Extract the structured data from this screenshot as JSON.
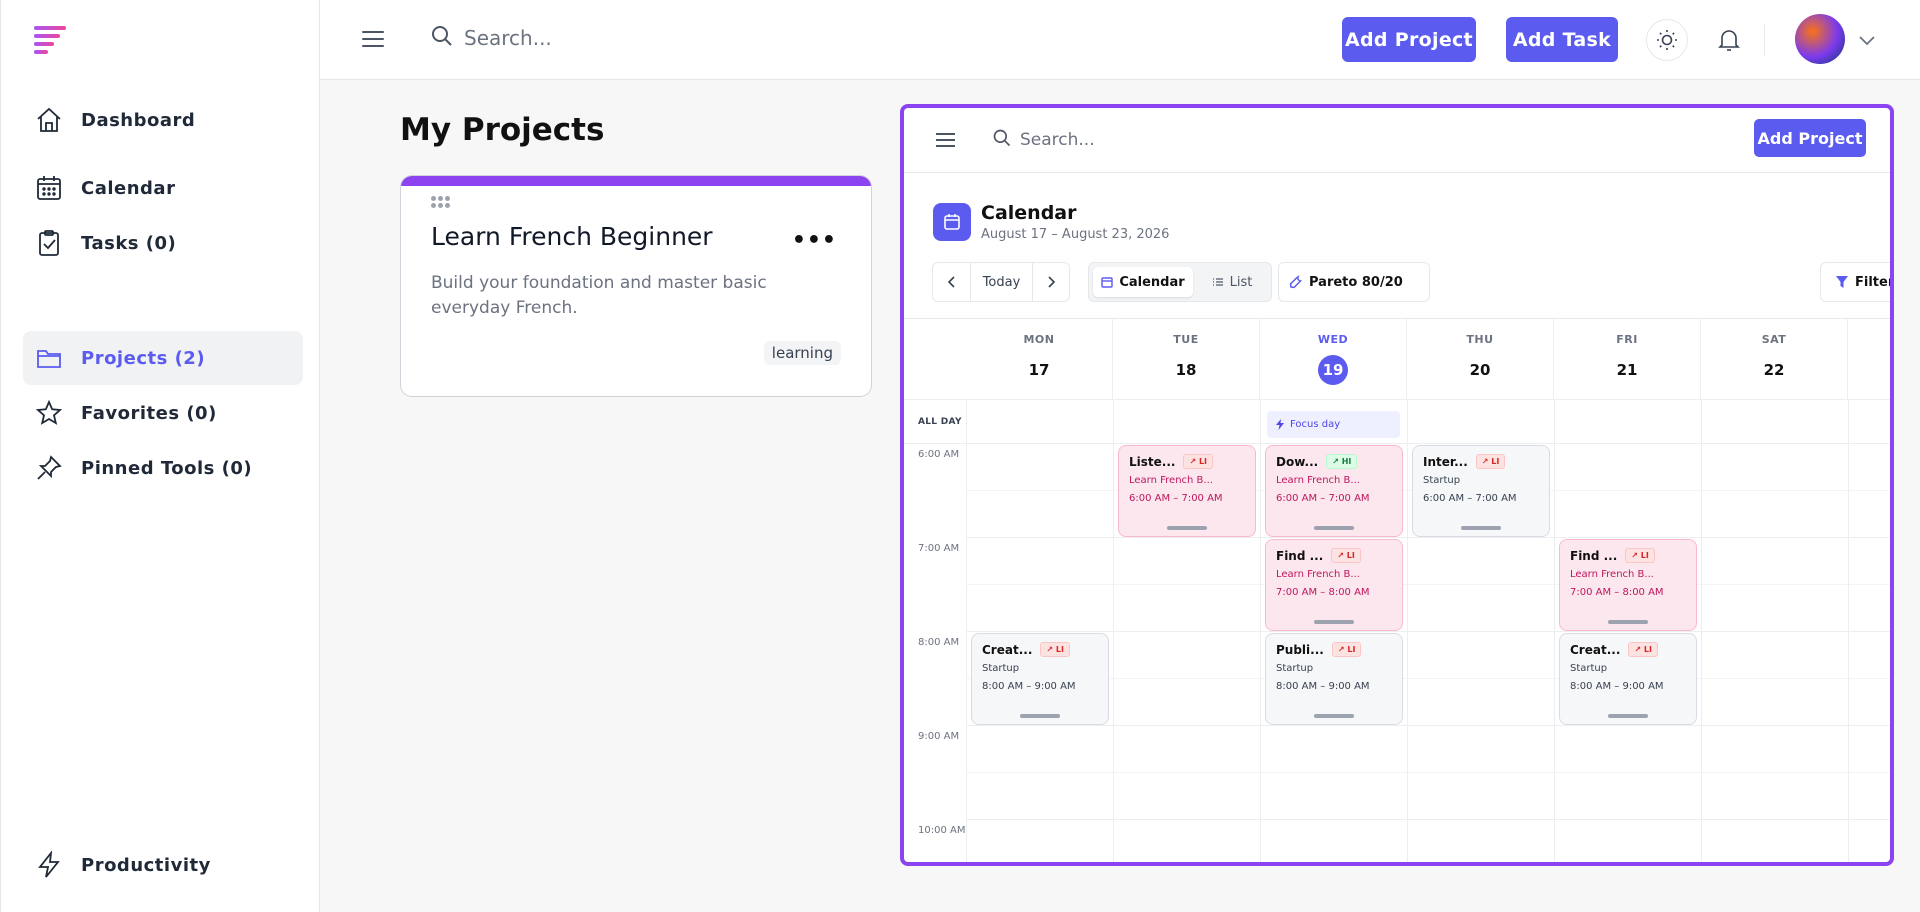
{
  "sidebar": {
    "items": [
      {
        "label": "Dashboard",
        "icon": "home-icon"
      },
      {
        "label": "Calendar",
        "icon": "calendar-icon"
      },
      {
        "label": "Tasks (0)",
        "icon": "clipboard-check-icon"
      },
      {
        "label": "Projects (2)",
        "icon": "folder-icon",
        "active": true
      },
      {
        "label": "Favorites (0)",
        "icon": "star-icon"
      },
      {
        "label": "Pinned Tools (0)",
        "icon": "pin-icon"
      }
    ],
    "footer_label": "Productivity"
  },
  "topbar": {
    "search_placeholder": "Search...",
    "add_project": "Add Project",
    "add_task": "Add Task"
  },
  "main": {
    "title": "My Projects",
    "project": {
      "title": "Learn French Beginner",
      "description": "Build your foundation and master basic everyday French.",
      "tag": "learning",
      "accent": "#8b44f0"
    }
  },
  "calendar": {
    "search_placeholder": "Search...",
    "add_project": "Add Project",
    "title": "Calendar",
    "range": "August 17 – August 23, 2026",
    "today_label": "Today",
    "view_calendar": "Calendar",
    "view_list": "List",
    "pareto": "Pareto 80/20",
    "filters": "Filters",
    "days": [
      {
        "dow": "MON",
        "num": "17"
      },
      {
        "dow": "TUE",
        "num": "18"
      },
      {
        "dow": "WED",
        "num": "19",
        "today": true
      },
      {
        "dow": "THU",
        "num": "20"
      },
      {
        "dow": "FRI",
        "num": "21"
      },
      {
        "dow": "SAT",
        "num": "22"
      }
    ],
    "allday_label": "ALL DAY",
    "focus_label": "Focus day",
    "times": [
      "6:00 AM",
      "7:00 AM",
      "8:00 AM",
      "9:00 AM",
      "10:00 AM"
    ],
    "events": [
      {
        "title": "Liste...",
        "badge": "LI",
        "sub": "Learn French B...",
        "time": "6:00 AM – 7:00 AM",
        "style": "pink"
      },
      {
        "title": "Dow...",
        "badge": "HI",
        "sub": "Learn French B...",
        "time": "6:00 AM – 7:00 AM",
        "style": "pink"
      },
      {
        "title": "Inter...",
        "badge": "LI",
        "sub": "Startup",
        "time": "6:00 AM – 7:00 AM",
        "style": "gray"
      },
      {
        "title": "Find ...",
        "badge": "LI",
        "sub": "Learn French B...",
        "time": "7:00 AM – 8:00 AM",
        "style": "pink"
      },
      {
        "title": "Find ...",
        "badge": "LI",
        "sub": "Learn French B...",
        "time": "7:00 AM – 8:00 AM",
        "style": "pink"
      },
      {
        "title": "Creat...",
        "badge": "LI",
        "sub": "Startup",
        "time": "8:00 AM – 9:00 AM",
        "style": "gray"
      },
      {
        "title": "Publi...",
        "badge": "LI",
        "sub": "Startup",
        "time": "8:00 AM – 9:00 AM",
        "style": "gray"
      },
      {
        "title": "Creat...",
        "badge": "LI",
        "sub": "Startup",
        "time": "8:00 AM – 9:00 AM",
        "style": "gray"
      }
    ]
  },
  "colors": {
    "primary": "#5b5bf0",
    "accent": "#8b44f0"
  }
}
